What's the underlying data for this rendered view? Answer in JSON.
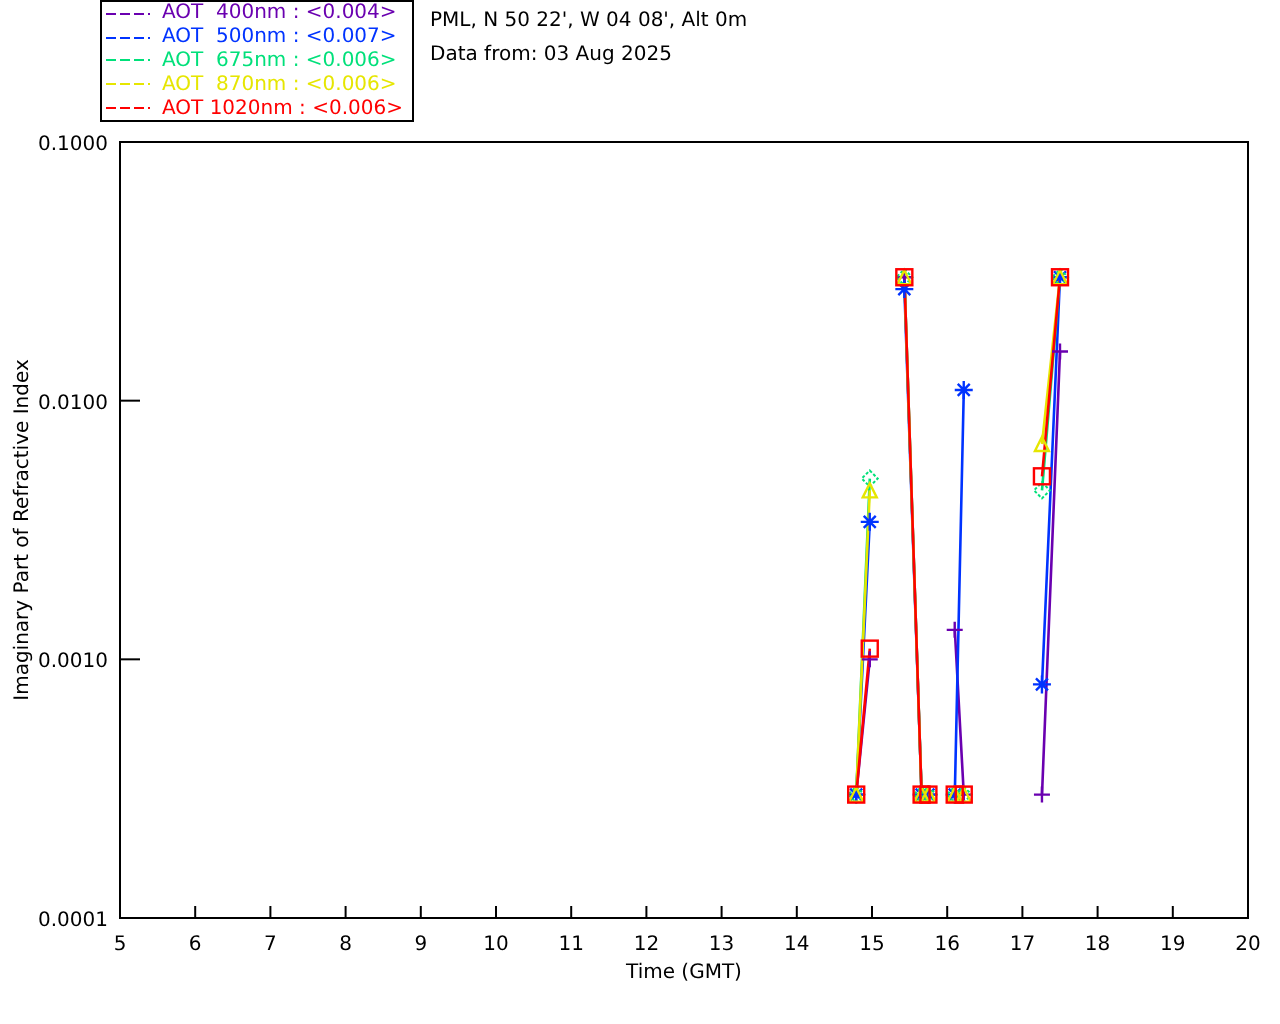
{
  "legend": [
    {
      "text": "AOT  400nm : <0.004>",
      "color": "#6a00b0"
    },
    {
      "text": "AOT  500nm : <0.007>",
      "color": "#0033ff"
    },
    {
      "text": "AOT  675nm : <0.006>",
      "color": "#00e07a"
    },
    {
      "text": "AOT  870nm : <0.006>",
      "color": "#e6e600"
    },
    {
      "text": "AOT 1020nm : <0.006>",
      "color": "#ff0000"
    }
  ],
  "site": {
    "location": "PML, N 50 22', W 04 08', Alt 0m",
    "date": "Data from: 03 Aug 2025"
  },
  "plot": {
    "x_axis": {
      "title": "Time (GMT)",
      "ticks": [
        "5",
        "6",
        "7",
        "8",
        "9",
        "10",
        "11",
        "12",
        "13",
        "14",
        "15",
        "16",
        "17",
        "18",
        "19",
        "20"
      ]
    },
    "y_axis": {
      "title": "Imaginary Part of Refractive Index",
      "ticks": [
        "0.1000",
        "0.0100",
        "0.0010",
        "0.0001"
      ]
    }
  }
}
